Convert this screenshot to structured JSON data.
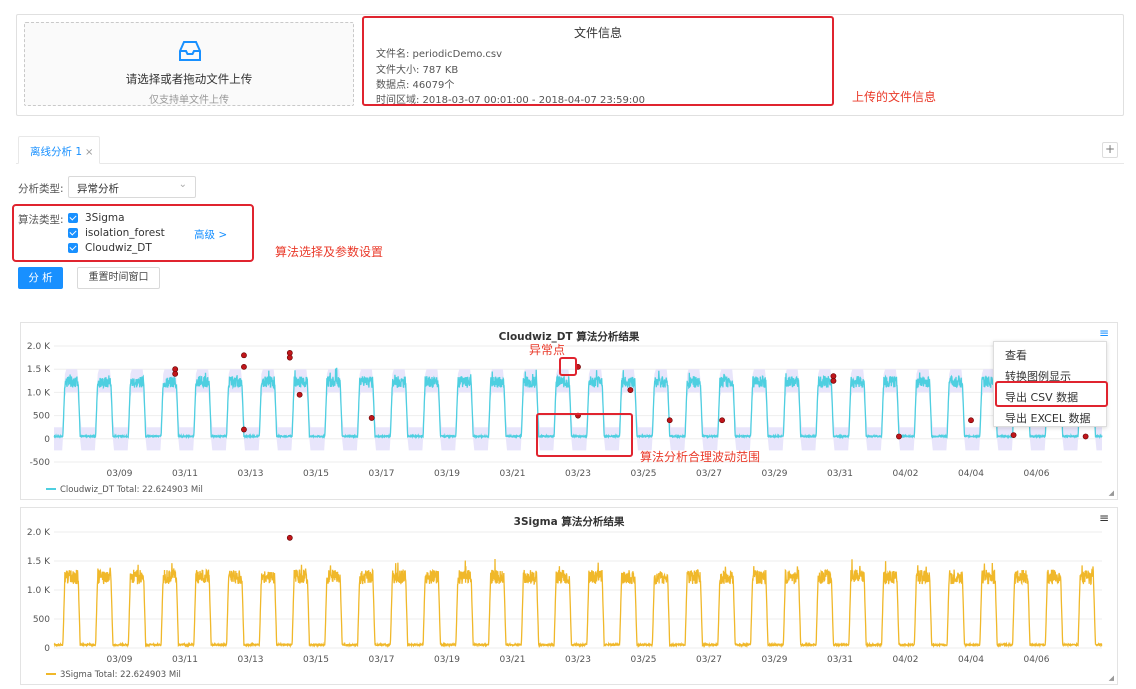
{
  "upload": {
    "title": "请选择或者拖动文件上传",
    "hint": "仅支持单文件上传",
    "icon": "inbox-icon"
  },
  "file_info": {
    "title": "文件信息",
    "rows": [
      "文件名: periodicDemo.csv",
      "文件大小: 787 KB",
      "数据点: 46079个",
      "时间区域: 2018-03-07 00:01:00 - 2018-04-07 23:59:00"
    ],
    "annotation": "上传的文件信息"
  },
  "tabs": [
    {
      "label": "离线分析 1",
      "close": "×"
    }
  ],
  "tab_add": "+",
  "analysis_type": {
    "label": "分析类型:",
    "value": "异常分析"
  },
  "algorithms": {
    "label": "算法类型:",
    "items": [
      "3Sigma",
      "isolation_forest",
      "Cloudwiz_DT"
    ],
    "advanced": "高级 >",
    "annotation": "算法选择及参数设置"
  },
  "buttons": {
    "analyze": "分 析",
    "reset": "重置时间窗口"
  },
  "context_menu": {
    "items": [
      "查看",
      "转换图例显示",
      "导出 CSV 数据",
      "导出 EXCEL 数据"
    ]
  },
  "annotations": {
    "anomaly": "异常点",
    "band": "算法分析合理波动范围"
  },
  "colors": {
    "primary": "#1890ff",
    "highlight": "#e0242f",
    "cyan": "#4ecfe0",
    "gold": "#f0b82a",
    "band": "#e6e2fb"
  },
  "chart_data": [
    {
      "type": "line",
      "title": "Cloudwiz_DT 算法分析结果",
      "y_ticks": [
        "2.0 K",
        "1.5 K",
        "1.0 K",
        "500",
        "0",
        "-500"
      ],
      "ylim": [
        -500,
        2000
      ],
      "x_ticks": [
        "03/09",
        "03/11",
        "03/13",
        "03/15",
        "03/17",
        "03/19",
        "03/21",
        "03/23",
        "03/25",
        "03/27",
        "03/29",
        "03/31",
        "04/02",
        "04/04",
        "04/06"
      ],
      "legend": "Cloudwiz_DT  Total: 22.624903 Mil",
      "series": [
        {
          "name": "Cloudwiz_DT",
          "pattern": "daily cycle, peaks ~1300, troughs ~50",
          "days": 32
        }
      ],
      "anomalies": [
        {
          "day": 3.7,
          "value": 1500
        },
        {
          "day": 3.7,
          "value": 1400
        },
        {
          "day": 5.8,
          "value": 1800
        },
        {
          "day": 5.8,
          "value": 1550
        },
        {
          "day": 5.8,
          "value": 200
        },
        {
          "day": 7.2,
          "value": 1850
        },
        {
          "day": 7.2,
          "value": 1750
        },
        {
          "day": 7.5,
          "value": 950
        },
        {
          "day": 9.7,
          "value": 450
        },
        {
          "day": 16.0,
          "value": 1550
        },
        {
          "day": 16.0,
          "value": 500
        },
        {
          "day": 17.6,
          "value": 1050
        },
        {
          "day": 18.8,
          "value": 400
        },
        {
          "day": 20.4,
          "value": 400
        },
        {
          "day": 23.8,
          "value": 1350
        },
        {
          "day": 23.8,
          "value": 1250
        },
        {
          "day": 25.8,
          "value": 50
        },
        {
          "day": 28.0,
          "value": 400
        },
        {
          "day": 29.3,
          "value": 80
        },
        {
          "day": 31.5,
          "value": 50
        }
      ]
    },
    {
      "type": "line",
      "title": "3Sigma 算法分析结果",
      "y_ticks": [
        "2.0 K",
        "1.5 K",
        "1.0 K",
        "500",
        "0"
      ],
      "ylim": [
        0,
        2000
      ],
      "x_ticks": [
        "03/09",
        "03/11",
        "03/13",
        "03/15",
        "03/17",
        "03/19",
        "03/21",
        "03/23",
        "03/25",
        "03/27",
        "03/29",
        "03/31",
        "04/02",
        "04/04",
        "04/06"
      ],
      "legend": "3Sigma  Total: 22.624903 Mil",
      "series": [
        {
          "name": "3Sigma",
          "pattern": "daily cycle, peaks ~1300, troughs ~50",
          "days": 32
        }
      ],
      "anomalies": [
        {
          "day": 7.2,
          "value": 1900
        }
      ]
    }
  ]
}
